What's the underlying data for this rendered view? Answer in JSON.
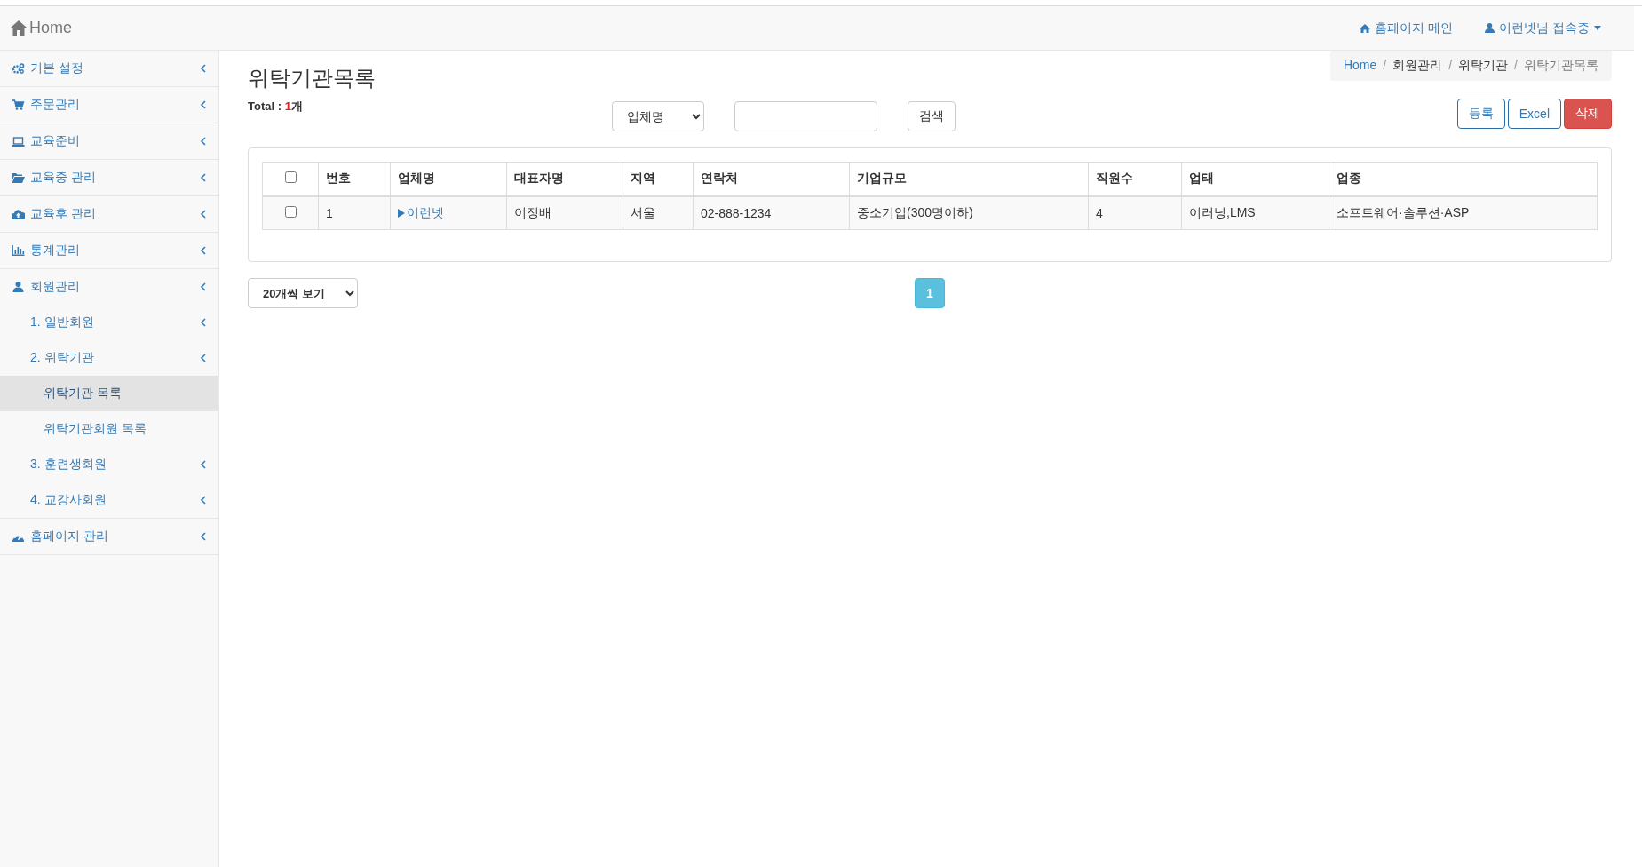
{
  "header": {
    "brand": "Home",
    "links": [
      {
        "label": "홈페이지 메인"
      },
      {
        "label": "이런넷님 접속중"
      }
    ]
  },
  "sidebar": {
    "items": [
      {
        "label": "기본 설정",
        "selected": false
      },
      {
        "label": "주문관리",
        "selected": false
      },
      {
        "label": "교육준비",
        "selected": false
      },
      {
        "label": "교육중 관리",
        "selected": false
      },
      {
        "label": "교육후 관리",
        "selected": false
      },
      {
        "label": "통계관리",
        "selected": false
      },
      {
        "label": "회원관리",
        "selected": false,
        "children": [
          {
            "label": "1. 일반회원",
            "selected": false
          },
          {
            "label": "2. 위탁기관",
            "selected": false,
            "children": [
              {
                "label": "위탁기관 목록",
                "selected": true
              },
              {
                "label": "위탁기관회원 목록",
                "selected": false
              }
            ]
          },
          {
            "label": "3. 훈련생회원",
            "selected": false
          },
          {
            "label": "4. 교강사회원",
            "selected": false
          }
        ]
      },
      {
        "label": "홈페이지 관리",
        "selected": false
      }
    ]
  },
  "breadcrumb": [
    "Home",
    "회원관리",
    "위탁기관",
    "위탁기관목록"
  ],
  "breadcrumb_separator": "/",
  "page": {
    "title": "위탁기관목록",
    "total_label": "Total : ",
    "total_count": "1",
    "total_unit": "개"
  },
  "search": {
    "filter": "업체명",
    "button": "검색"
  },
  "actions": [
    {
      "label": "등록",
      "kind": "outline"
    },
    {
      "label": "Excel",
      "kind": "outline"
    },
    {
      "label": "삭제",
      "kind": "danger"
    }
  ],
  "table": {
    "header_checked": false,
    "columns": [
      "번호",
      "업체명",
      "대표자명",
      "지역",
      "연락처",
      "기업규모",
      "직원수",
      "업태",
      "업종"
    ],
    "rows": [
      {
        "checked": false,
        "cells": [
          "1",
          "이런넷",
          "이정배",
          "서울",
          "02-888-1234",
          "중소기업(300명이하)",
          "4",
          "이러닝,LMS",
          "소프트웨어·솔루션·ASP"
        ]
      }
    ]
  },
  "page_size": "20개씩 보기",
  "pagination": [
    {
      "label": "1",
      "selected": true
    }
  ]
}
